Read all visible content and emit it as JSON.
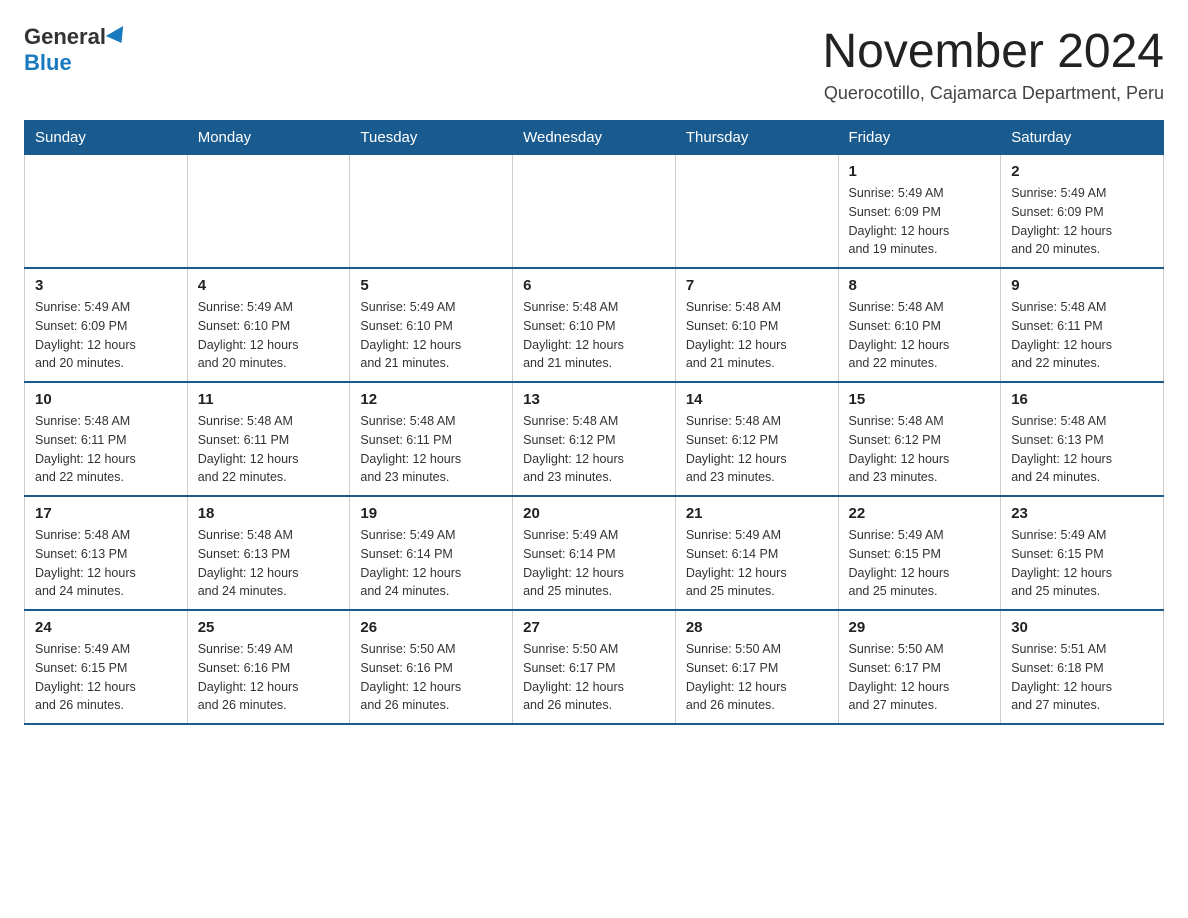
{
  "header": {
    "logo_general": "General",
    "logo_blue": "Blue",
    "month_title": "November 2024",
    "location": "Querocotillo, Cajamarca Department, Peru"
  },
  "days_of_week": [
    "Sunday",
    "Monday",
    "Tuesday",
    "Wednesday",
    "Thursday",
    "Friday",
    "Saturday"
  ],
  "weeks": [
    [
      {
        "day": "",
        "info": ""
      },
      {
        "day": "",
        "info": ""
      },
      {
        "day": "",
        "info": ""
      },
      {
        "day": "",
        "info": ""
      },
      {
        "day": "",
        "info": ""
      },
      {
        "day": "1",
        "info": "Sunrise: 5:49 AM\nSunset: 6:09 PM\nDaylight: 12 hours\nand 19 minutes."
      },
      {
        "day": "2",
        "info": "Sunrise: 5:49 AM\nSunset: 6:09 PM\nDaylight: 12 hours\nand 20 minutes."
      }
    ],
    [
      {
        "day": "3",
        "info": "Sunrise: 5:49 AM\nSunset: 6:09 PM\nDaylight: 12 hours\nand 20 minutes."
      },
      {
        "day": "4",
        "info": "Sunrise: 5:49 AM\nSunset: 6:10 PM\nDaylight: 12 hours\nand 20 minutes."
      },
      {
        "day": "5",
        "info": "Sunrise: 5:49 AM\nSunset: 6:10 PM\nDaylight: 12 hours\nand 21 minutes."
      },
      {
        "day": "6",
        "info": "Sunrise: 5:48 AM\nSunset: 6:10 PM\nDaylight: 12 hours\nand 21 minutes."
      },
      {
        "day": "7",
        "info": "Sunrise: 5:48 AM\nSunset: 6:10 PM\nDaylight: 12 hours\nand 21 minutes."
      },
      {
        "day": "8",
        "info": "Sunrise: 5:48 AM\nSunset: 6:10 PM\nDaylight: 12 hours\nand 22 minutes."
      },
      {
        "day": "9",
        "info": "Sunrise: 5:48 AM\nSunset: 6:11 PM\nDaylight: 12 hours\nand 22 minutes."
      }
    ],
    [
      {
        "day": "10",
        "info": "Sunrise: 5:48 AM\nSunset: 6:11 PM\nDaylight: 12 hours\nand 22 minutes."
      },
      {
        "day": "11",
        "info": "Sunrise: 5:48 AM\nSunset: 6:11 PM\nDaylight: 12 hours\nand 22 minutes."
      },
      {
        "day": "12",
        "info": "Sunrise: 5:48 AM\nSunset: 6:11 PM\nDaylight: 12 hours\nand 23 minutes."
      },
      {
        "day": "13",
        "info": "Sunrise: 5:48 AM\nSunset: 6:12 PM\nDaylight: 12 hours\nand 23 minutes."
      },
      {
        "day": "14",
        "info": "Sunrise: 5:48 AM\nSunset: 6:12 PM\nDaylight: 12 hours\nand 23 minutes."
      },
      {
        "day": "15",
        "info": "Sunrise: 5:48 AM\nSunset: 6:12 PM\nDaylight: 12 hours\nand 23 minutes."
      },
      {
        "day": "16",
        "info": "Sunrise: 5:48 AM\nSunset: 6:13 PM\nDaylight: 12 hours\nand 24 minutes."
      }
    ],
    [
      {
        "day": "17",
        "info": "Sunrise: 5:48 AM\nSunset: 6:13 PM\nDaylight: 12 hours\nand 24 minutes."
      },
      {
        "day": "18",
        "info": "Sunrise: 5:48 AM\nSunset: 6:13 PM\nDaylight: 12 hours\nand 24 minutes."
      },
      {
        "day": "19",
        "info": "Sunrise: 5:49 AM\nSunset: 6:14 PM\nDaylight: 12 hours\nand 24 minutes."
      },
      {
        "day": "20",
        "info": "Sunrise: 5:49 AM\nSunset: 6:14 PM\nDaylight: 12 hours\nand 25 minutes."
      },
      {
        "day": "21",
        "info": "Sunrise: 5:49 AM\nSunset: 6:14 PM\nDaylight: 12 hours\nand 25 minutes."
      },
      {
        "day": "22",
        "info": "Sunrise: 5:49 AM\nSunset: 6:15 PM\nDaylight: 12 hours\nand 25 minutes."
      },
      {
        "day": "23",
        "info": "Sunrise: 5:49 AM\nSunset: 6:15 PM\nDaylight: 12 hours\nand 25 minutes."
      }
    ],
    [
      {
        "day": "24",
        "info": "Sunrise: 5:49 AM\nSunset: 6:15 PM\nDaylight: 12 hours\nand 26 minutes."
      },
      {
        "day": "25",
        "info": "Sunrise: 5:49 AM\nSunset: 6:16 PM\nDaylight: 12 hours\nand 26 minutes."
      },
      {
        "day": "26",
        "info": "Sunrise: 5:50 AM\nSunset: 6:16 PM\nDaylight: 12 hours\nand 26 minutes."
      },
      {
        "day": "27",
        "info": "Sunrise: 5:50 AM\nSunset: 6:17 PM\nDaylight: 12 hours\nand 26 minutes."
      },
      {
        "day": "28",
        "info": "Sunrise: 5:50 AM\nSunset: 6:17 PM\nDaylight: 12 hours\nand 26 minutes."
      },
      {
        "day": "29",
        "info": "Sunrise: 5:50 AM\nSunset: 6:17 PM\nDaylight: 12 hours\nand 27 minutes."
      },
      {
        "day": "30",
        "info": "Sunrise: 5:51 AM\nSunset: 6:18 PM\nDaylight: 12 hours\nand 27 minutes."
      }
    ]
  ]
}
